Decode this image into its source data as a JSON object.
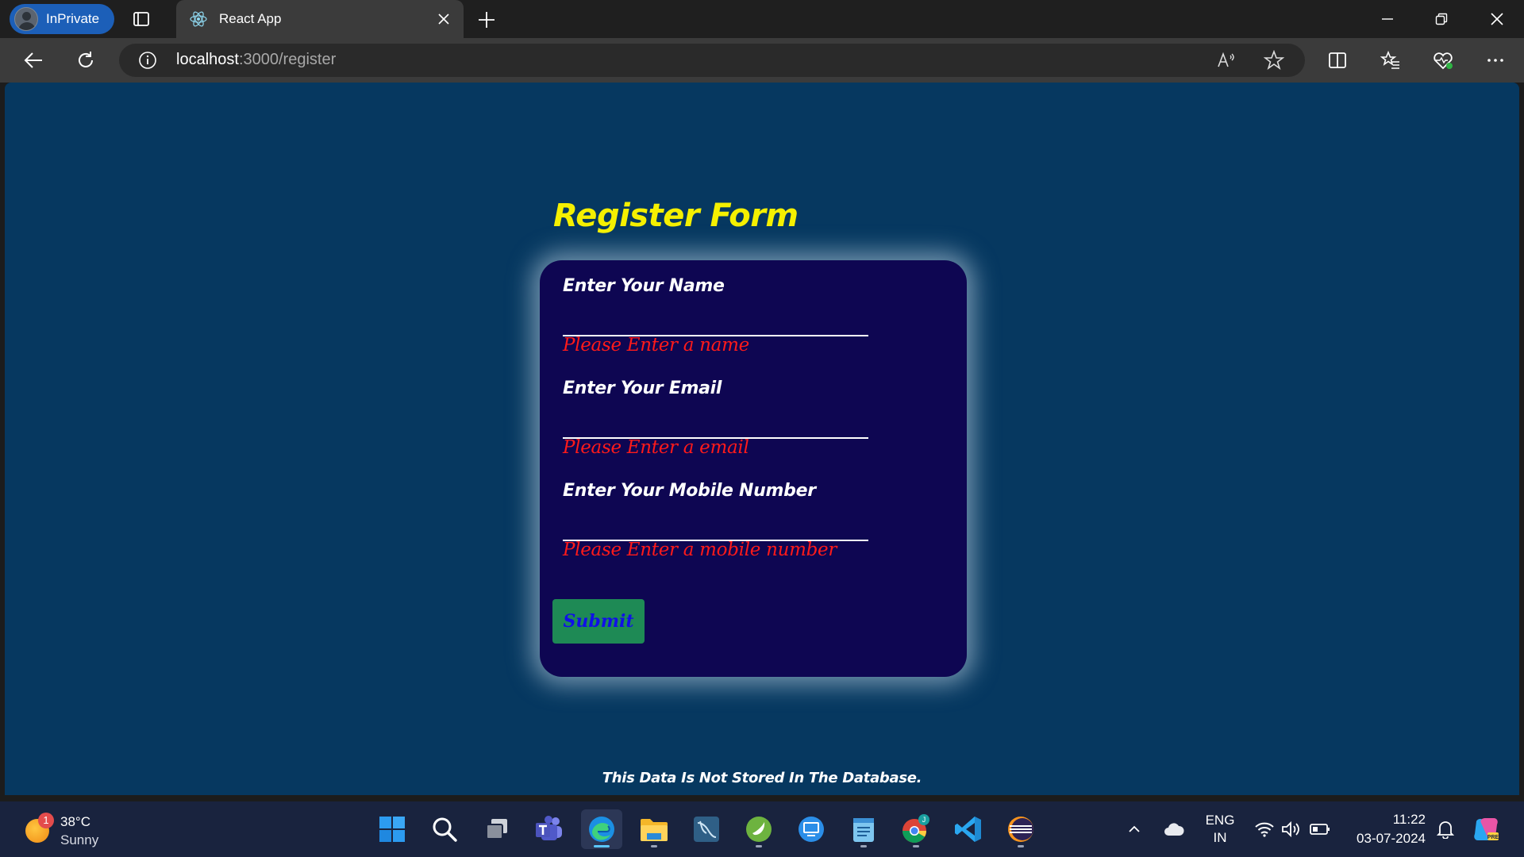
{
  "browser": {
    "profile_label": "InPrivate",
    "tab_title": "React App",
    "url_host": "localhost",
    "url_path": ":3000/register"
  },
  "page": {
    "title": "Register Form",
    "fields": [
      {
        "label": "Enter Your Name",
        "value": "",
        "error": "Please Enter a name"
      },
      {
        "label": "Enter Your Email",
        "value": "",
        "error": "Please Enter a email"
      },
      {
        "label": "Enter Your Mobile Number",
        "value": "",
        "error": "Please Enter a mobile number"
      }
    ],
    "submit_label": "Submit",
    "footer_note": "This Data Is Not Stored In The Database."
  },
  "taskbar": {
    "weather_temp": "38°C",
    "weather_condition": "Sunny",
    "weather_badge": "1",
    "apps": [
      "start-icon",
      "search-icon",
      "task-view-icon",
      "teams-icon",
      "edge-icon",
      "file-explorer-icon",
      "mysql-workbench-icon",
      "spring-tool-icon",
      "remote-desktop-icon",
      "notepad-icon",
      "chrome-icon",
      "vscode-icon",
      "eclipse-icon"
    ],
    "language_line1": "ENG",
    "language_line2": "IN",
    "time": "11:22",
    "date": "03-07-2024"
  },
  "colors": {
    "page_bg": "#063860",
    "card_bg": "#0e0652",
    "title": "#f5f000",
    "error": "#ff1a1a",
    "submit_bg": "#1e8a55",
    "submit_text": "#1010e8"
  }
}
